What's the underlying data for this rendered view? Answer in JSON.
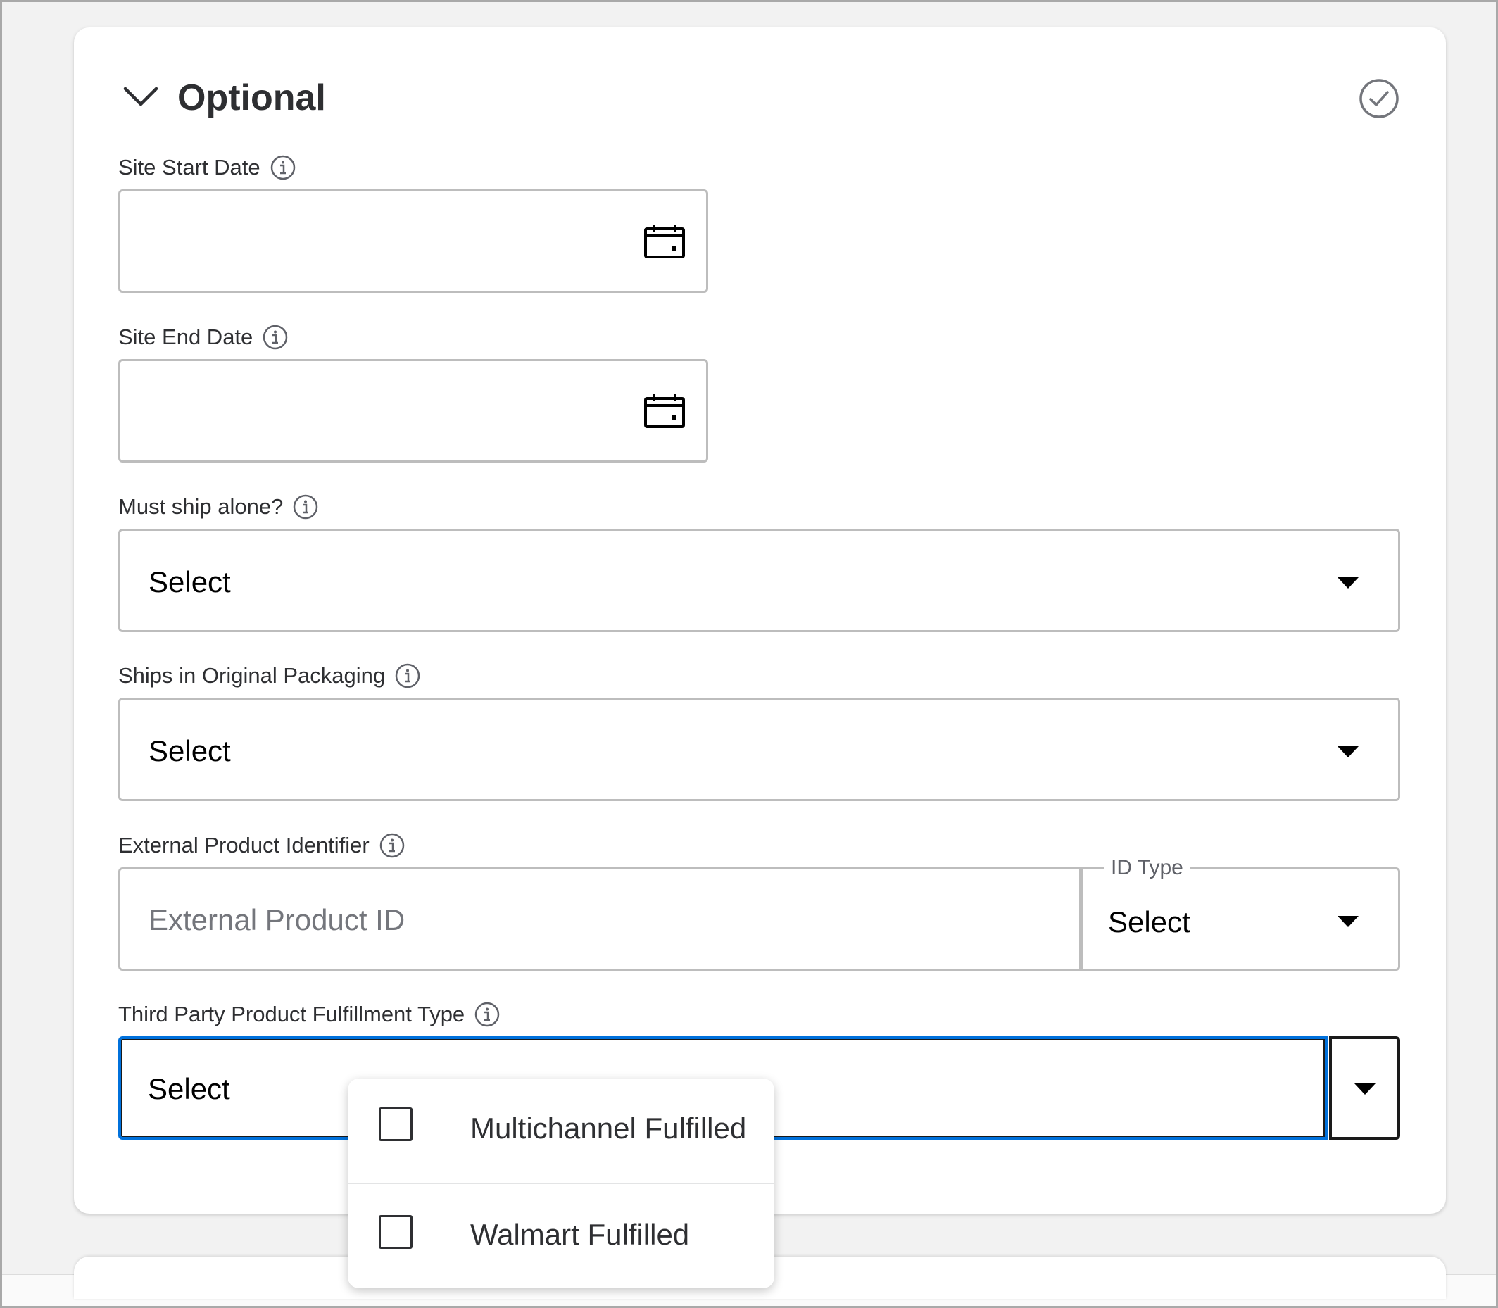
{
  "section": {
    "title": "Optional",
    "icons": {
      "collapse": "chevron-down-icon",
      "status": "check-circle-icon"
    }
  },
  "fields": {
    "site_start_date": {
      "label": "Site Start Date",
      "value": ""
    },
    "site_end_date": {
      "label": "Site End Date",
      "value": ""
    },
    "must_ship_alone": {
      "label": "Must ship alone?",
      "value": "Select"
    },
    "ships_in_original_packaging": {
      "label": "Ships in Original Packaging",
      "value": "Select"
    },
    "external_product_identifier": {
      "label": "External Product Identifier",
      "placeholder": "External Product ID",
      "value": "",
      "id_type": {
        "legend": "ID Type",
        "value": "Select"
      }
    },
    "third_party_fulfillment_type": {
      "label": "Third Party Product Fulfillment Type",
      "value": "Select",
      "options": [
        {
          "label": "Multichannel Fulfilled",
          "checked": false
        },
        {
          "label": "Walmart Fulfilled",
          "checked": false
        }
      ]
    }
  },
  "colors": {
    "focus": "#0071dc",
    "text": "#2e2f32",
    "border": "#bdbdbd"
  }
}
